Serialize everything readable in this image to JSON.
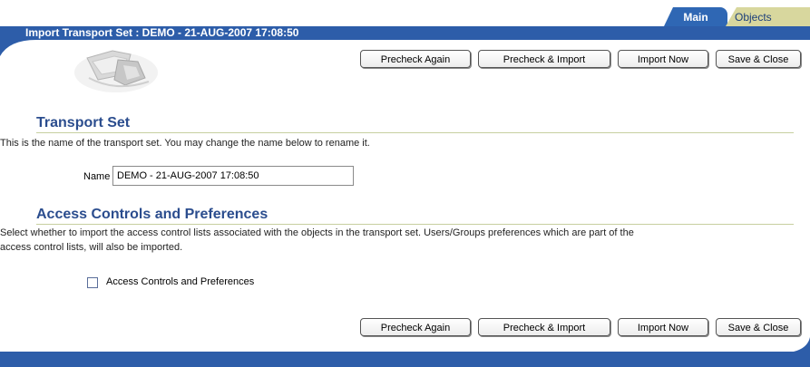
{
  "tabs": [
    {
      "label": "Main",
      "active": true
    },
    {
      "label": "Objects",
      "active": false
    }
  ],
  "title": "Import Transport Set : DEMO - 21-AUG-2007 17:08:50",
  "buttons": {
    "precheck_again": "Precheck Again",
    "precheck_import": "Precheck & Import",
    "import_now": "Import Now",
    "save_close": "Save & Close"
  },
  "transport_set": {
    "heading": "Transport Set",
    "description": "This is the name of the transport set.  You may change the name below to rename it.",
    "name_label": "Name",
    "name_value": "DEMO - 21-AUG-2007 17:08:50"
  },
  "access": {
    "heading": "Access Controls and Preferences",
    "description_line1": "Select whether to import the access control lists associated with the objects in the transport set. Users/Groups preferences which are part of the",
    "description_line2": "access control lists, will also be imported.",
    "checkbox_label": "Access Controls and Preferences",
    "checked": false
  },
  "colors": {
    "brand_blue": "#2d5da9",
    "heading_blue": "#2b4d8e",
    "inactive_tab": "#d8d79e"
  }
}
